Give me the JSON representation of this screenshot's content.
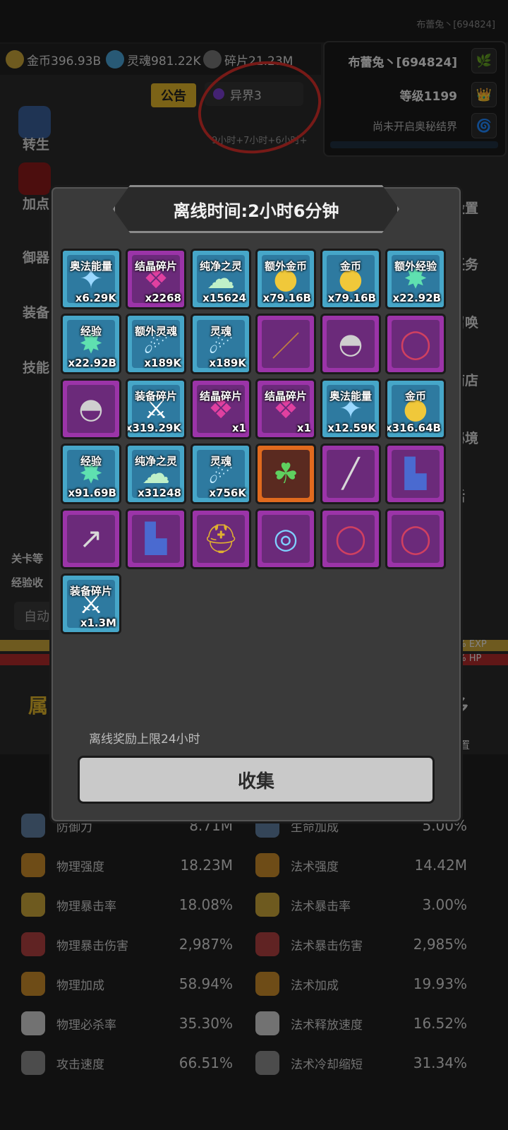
{
  "top": {
    "player_id": "布蕾兔丶[694824]"
  },
  "currency": [
    {
      "icon": "gold-coin-icon",
      "label": "金币396.93B"
    },
    {
      "icon": "soul-icon",
      "label": "灵魂981.22K"
    },
    {
      "icon": "shard-icon",
      "label": "碎片21.23M"
    }
  ],
  "player": {
    "name": "布蕾兔丶[694824]",
    "level": "等级1199",
    "mystic_realm": "尚未开启奥秘结界"
  },
  "background": {
    "notice_button": "公告",
    "otherworld": "异界3",
    "boost_text": "9小时+7小时+6小时+",
    "side_left": [
      "转生",
      "加点",
      "御器",
      "装备",
      "技能"
    ],
    "side_right": [
      "设置",
      "任务",
      "召唤",
      "商店",
      "秘境",
      "话"
    ],
    "level_label": "关卡等",
    "exp_label": "经验收",
    "auto_btn": "自动",
    "tab_left": "属",
    "tab_right": "多",
    "position": "位置",
    "exp_pct": "0% EXP",
    "hp_pct": "2% HP"
  },
  "stats": [
    {
      "name": "防御力",
      "value": "8.71M",
      "icon": "shield-icon",
      "name2": "生命加成",
      "value2": "5.00%",
      "icon2": "heart-plus-icon"
    },
    {
      "name": "物理强度",
      "value": "18.23M",
      "icon": "sword-icon",
      "name2": "法术强度",
      "value2": "14.42M",
      "icon2": "staff-icon"
    },
    {
      "name": "物理暴击率",
      "value": "18.08%",
      "icon": "crit-icon",
      "name2": "法术暴击率",
      "value2": "3.00%",
      "icon2": "magic-crit-icon"
    },
    {
      "name": "物理暴击伤害",
      "value": "2,987%",
      "icon": "crit-damage-icon",
      "name2": "法术暴击伤害",
      "value2": "2,985%",
      "icon2": "magic-crit-damage-icon"
    },
    {
      "name": "物理加成",
      "value": "58.94%",
      "icon": "fist-icon",
      "name2": "法术加成",
      "value2": "19.93%",
      "icon2": "wand-icon"
    },
    {
      "name": "物理必杀率",
      "value": "35.30%",
      "icon": "skull-icon",
      "name2": "法术释放速度",
      "value2": "16.52%",
      "icon2": "mushroom-icon"
    },
    {
      "name": "攻击速度",
      "value": "66.51%",
      "icon": "speed-icon",
      "name2": "法术冷却缩短",
      "value2": "31.34%",
      "icon2": "hourglass-icon"
    }
  ],
  "stats_top_partial": {
    "value": "%"
  },
  "modal": {
    "title": "离线时间:2小时6分钟",
    "note": "离线奖励上限24小时",
    "collect_button": "收集",
    "rewards": [
      {
        "name": "奥法能量",
        "qty": "x6.29K",
        "rarity": "blue",
        "icon": "arcane-crystal-icon"
      },
      {
        "name": "结晶碎片",
        "qty": "x2268",
        "rarity": "purple",
        "icon": "crystal-shard-icon"
      },
      {
        "name": "纯净之灵",
        "qty": "x15624",
        "rarity": "blue",
        "icon": "pure-spirit-icon"
      },
      {
        "name": "额外金币",
        "qty": "x79.16B",
        "rarity": "blue",
        "icon": "gold-coin-icon"
      },
      {
        "name": "金币",
        "qty": "x79.16B",
        "rarity": "blue",
        "icon": "gold-coin-icon"
      },
      {
        "name": "额外经验",
        "qty": "x22.92B",
        "rarity": "blue",
        "icon": "exp-star-icon"
      },
      {
        "name": "经验",
        "qty": "x22.92B",
        "rarity": "blue",
        "icon": "exp-star-icon"
      },
      {
        "name": "额外灵魂",
        "qty": "x189K",
        "rarity": "blue",
        "icon": "soul-icon"
      },
      {
        "name": "灵魂",
        "qty": "x189K",
        "rarity": "blue",
        "icon": "soul-icon"
      },
      {
        "name": "",
        "qty": "",
        "rarity": "purple",
        "icon": "staff-item-icon"
      },
      {
        "name": "",
        "qty": "",
        "rarity": "purple",
        "icon": "helmet-item-icon"
      },
      {
        "name": "",
        "qty": "",
        "rarity": "purple",
        "icon": "necklace-item-icon"
      },
      {
        "name": "",
        "qty": "",
        "rarity": "purple",
        "icon": "helmet-item-icon"
      },
      {
        "name": "装备碎片",
        "qty": "x319.29K",
        "rarity": "blue",
        "icon": "equipment-shard-icon"
      },
      {
        "name": "结晶碎片",
        "qty": "x1",
        "rarity": "purple",
        "icon": "crystal-shard-icon"
      },
      {
        "name": "结晶碎片",
        "qty": "x1",
        "rarity": "purple",
        "icon": "crystal-shard-icon"
      },
      {
        "name": "奥法能量",
        "qty": "x12.59K",
        "rarity": "blue",
        "icon": "arcane-crystal-icon"
      },
      {
        "name": "金币",
        "qty": "x316.64B",
        "rarity": "blue",
        "icon": "gold-coin-icon"
      },
      {
        "name": "经验",
        "qty": "x91.69B",
        "rarity": "blue",
        "icon": "exp-star-icon"
      },
      {
        "name": "纯净之灵",
        "qty": "x31248",
        "rarity": "blue",
        "icon": "pure-spirit-icon"
      },
      {
        "name": "灵魂",
        "qty": "x756K",
        "rarity": "blue",
        "icon": "soul-icon"
      },
      {
        "name": "",
        "qty": "",
        "rarity": "orange",
        "icon": "amulet-item-icon"
      },
      {
        "name": "",
        "qty": "",
        "rarity": "purple",
        "icon": "sword-item-icon"
      },
      {
        "name": "",
        "qty": "",
        "rarity": "purple",
        "icon": "boots-item-icon"
      },
      {
        "name": "",
        "qty": "",
        "rarity": "purple",
        "icon": "spear-item-icon"
      },
      {
        "name": "",
        "qty": "",
        "rarity": "purple",
        "icon": "boots-item-icon"
      },
      {
        "name": "",
        "qty": "",
        "rarity": "purple",
        "icon": "spartan-helmet-item-icon"
      },
      {
        "name": "",
        "qty": "",
        "rarity": "purple",
        "icon": "bracelet-item-icon"
      },
      {
        "name": "",
        "qty": "",
        "rarity": "purple",
        "icon": "necklace-item-icon"
      },
      {
        "name": "",
        "qty": "",
        "rarity": "purple",
        "icon": "necklace-item-icon"
      },
      {
        "name": "装备碎片",
        "qty": "x1.3M",
        "rarity": "blue",
        "icon": "equipment-shard-icon"
      }
    ]
  }
}
